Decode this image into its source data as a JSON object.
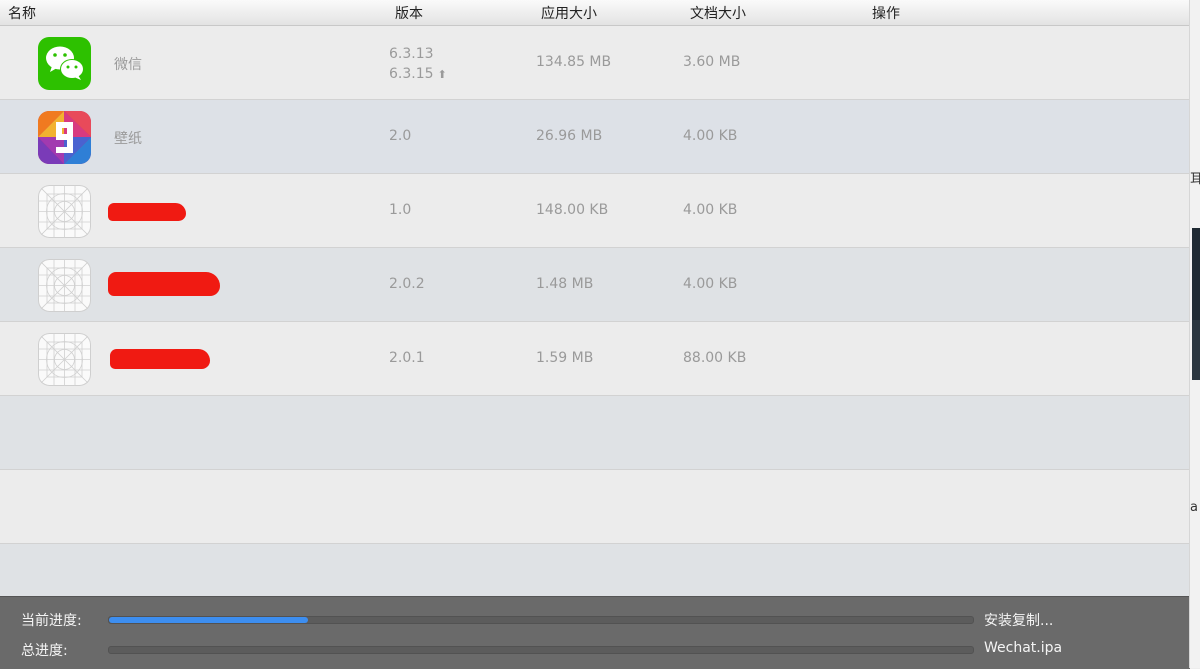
{
  "columns": {
    "name": "名称",
    "version": "版本",
    "app_size": "应用大小",
    "doc_size": "文档大小",
    "action": "操作"
  },
  "apps": [
    {
      "icon": "wechat-icon",
      "name": "微信",
      "version": "6.3.13",
      "update_version": "6.3.15",
      "app_size": "134.85 MB",
      "doc_size": "3.60 MB"
    },
    {
      "icon": "wallpaper-icon",
      "name": "壁纸",
      "version": "2.0",
      "app_size": "26.96 MB",
      "doc_size": "4.00 KB"
    },
    {
      "icon": "placeholder-app-icon",
      "name": "",
      "version": "1.0",
      "app_size": "148.00 KB",
      "doc_size": "4.00 KB"
    },
    {
      "icon": "placeholder-app-icon",
      "name": "",
      "version": "2.0.2",
      "app_size": "1.48 MB",
      "doc_size": "4.00 KB"
    },
    {
      "icon": "placeholder-app-icon",
      "name": "",
      "version": "2.0.1",
      "app_size": "1.59 MB",
      "doc_size": "88.00 KB"
    }
  ],
  "footer": {
    "current_label": "当前进度:",
    "total_label": "总进度:",
    "current_progress": 0.23,
    "total_progress": 0,
    "current_status": "安装复制...",
    "total_status": "Wechat.ipa"
  },
  "colors": {
    "progress_fill": "#3d8ef0",
    "wechat_green": "#2dc100",
    "redaction": "#f01a12"
  }
}
